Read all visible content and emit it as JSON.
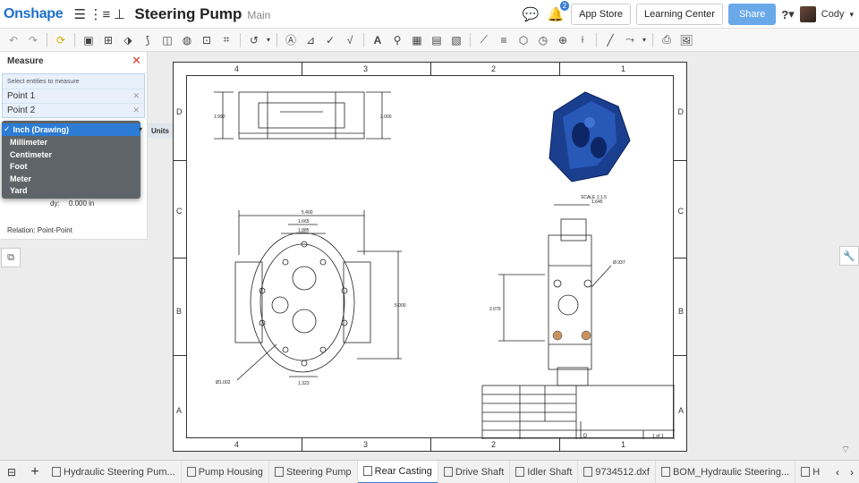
{
  "header": {
    "logo": "Onshape",
    "doc_title": "Steering Pump",
    "branch": "Main",
    "notification_count": "2",
    "app_store": "App Store",
    "learning_center": "Learning Center",
    "share": "Share",
    "help": "?",
    "user": "Cody"
  },
  "measure_panel": {
    "title": "Measure",
    "hint": "Select entities to measure",
    "points": [
      "Point 1",
      "Point 2"
    ],
    "dy_label": "dy:",
    "dy_value": "0.000 in",
    "relation": "Relation: Point-Point",
    "units_label": "Units",
    "units_options": [
      {
        "label": "Inch (Drawing)",
        "selected": true
      },
      {
        "label": "Millimeter",
        "selected": false
      },
      {
        "label": "Centimeter",
        "selected": false
      },
      {
        "label": "Foot",
        "selected": false
      },
      {
        "label": "Meter",
        "selected": false
      },
      {
        "label": "Yard",
        "selected": false
      }
    ]
  },
  "drawing": {
    "zone_columns": [
      "4",
      "3",
      "2",
      "1"
    ],
    "zone_rows": [
      "D",
      "C",
      "B",
      "A"
    ],
    "dimensions": {
      "top_left": "1.990",
      "top_right": "2.000",
      "width": "5.400",
      "hole_a": "1.885",
      "hole_b": "1.665",
      "height": "5.000",
      "bottom": "1.323",
      "dia_small": "Ø1.002",
      "side_width": "1.645",
      "side_dia": "Ø.937",
      "side_height": "2.079"
    },
    "iso_scale": "SCALE 1:1.5",
    "title_block_size": "D",
    "title_block_sheet": "1 of 1"
  },
  "tabs": [
    {
      "label": "Hydraulic Steering Pum...",
      "active": false
    },
    {
      "label": "Pump Housing",
      "active": false
    },
    {
      "label": "Steering Pump",
      "active": false
    },
    {
      "label": "Rear Casting",
      "active": true
    },
    {
      "label": "Drive Shaft",
      "active": false
    },
    {
      "label": "Idler Shaft",
      "active": false
    },
    {
      "label": "9734512.dxf",
      "active": false
    },
    {
      "label": "BOM_Hydraulic Steering...",
      "active": false
    },
    {
      "label": "H",
      "active": false
    }
  ]
}
